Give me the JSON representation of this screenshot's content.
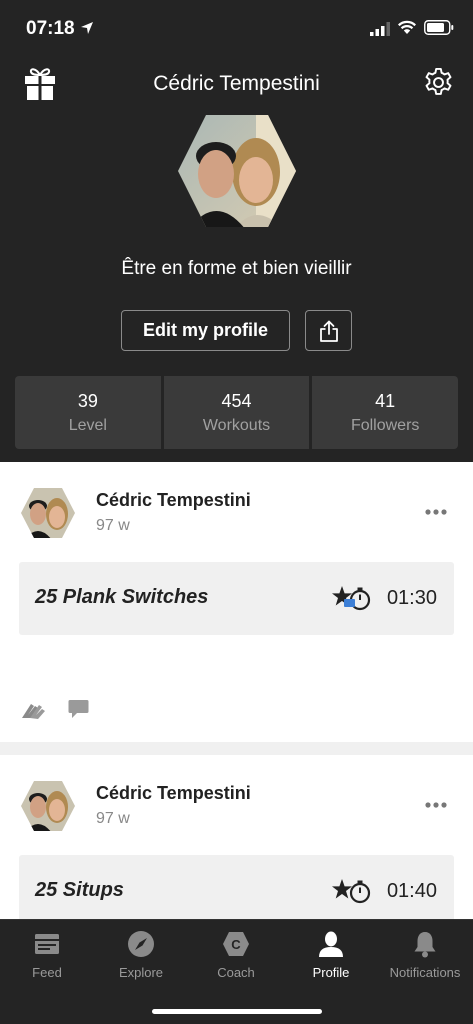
{
  "status_bar": {
    "time": "07:18"
  },
  "header": {
    "name": "Cédric Tempestini"
  },
  "profile": {
    "bio": "Être en forme et bien vieillir",
    "edit_label": "Edit my profile"
  },
  "stats": [
    {
      "value": "39",
      "label": "Level"
    },
    {
      "value": "454",
      "label": "Workouts"
    },
    {
      "value": "41",
      "label": "Followers"
    }
  ],
  "feed": [
    {
      "author": "Cédric Tempestini",
      "age": "97 w",
      "workout": "25 Plank Switches",
      "time": "01:30"
    },
    {
      "author": "Cédric Tempestini",
      "age": "97 w",
      "workout": "25 Situps",
      "time": "01:40"
    }
  ],
  "tabs": [
    {
      "label": "Feed",
      "icon": "feed-icon"
    },
    {
      "label": "Explore",
      "icon": "compass-icon"
    },
    {
      "label": "Coach",
      "icon": "coach-icon"
    },
    {
      "label": "Profile",
      "icon": "person-icon",
      "active": true
    },
    {
      "label": "Notifications",
      "icon": "bell-icon"
    }
  ],
  "colors": {
    "background": "#242424",
    "tile": "#3a3a3a",
    "accent": "#ffffff"
  }
}
